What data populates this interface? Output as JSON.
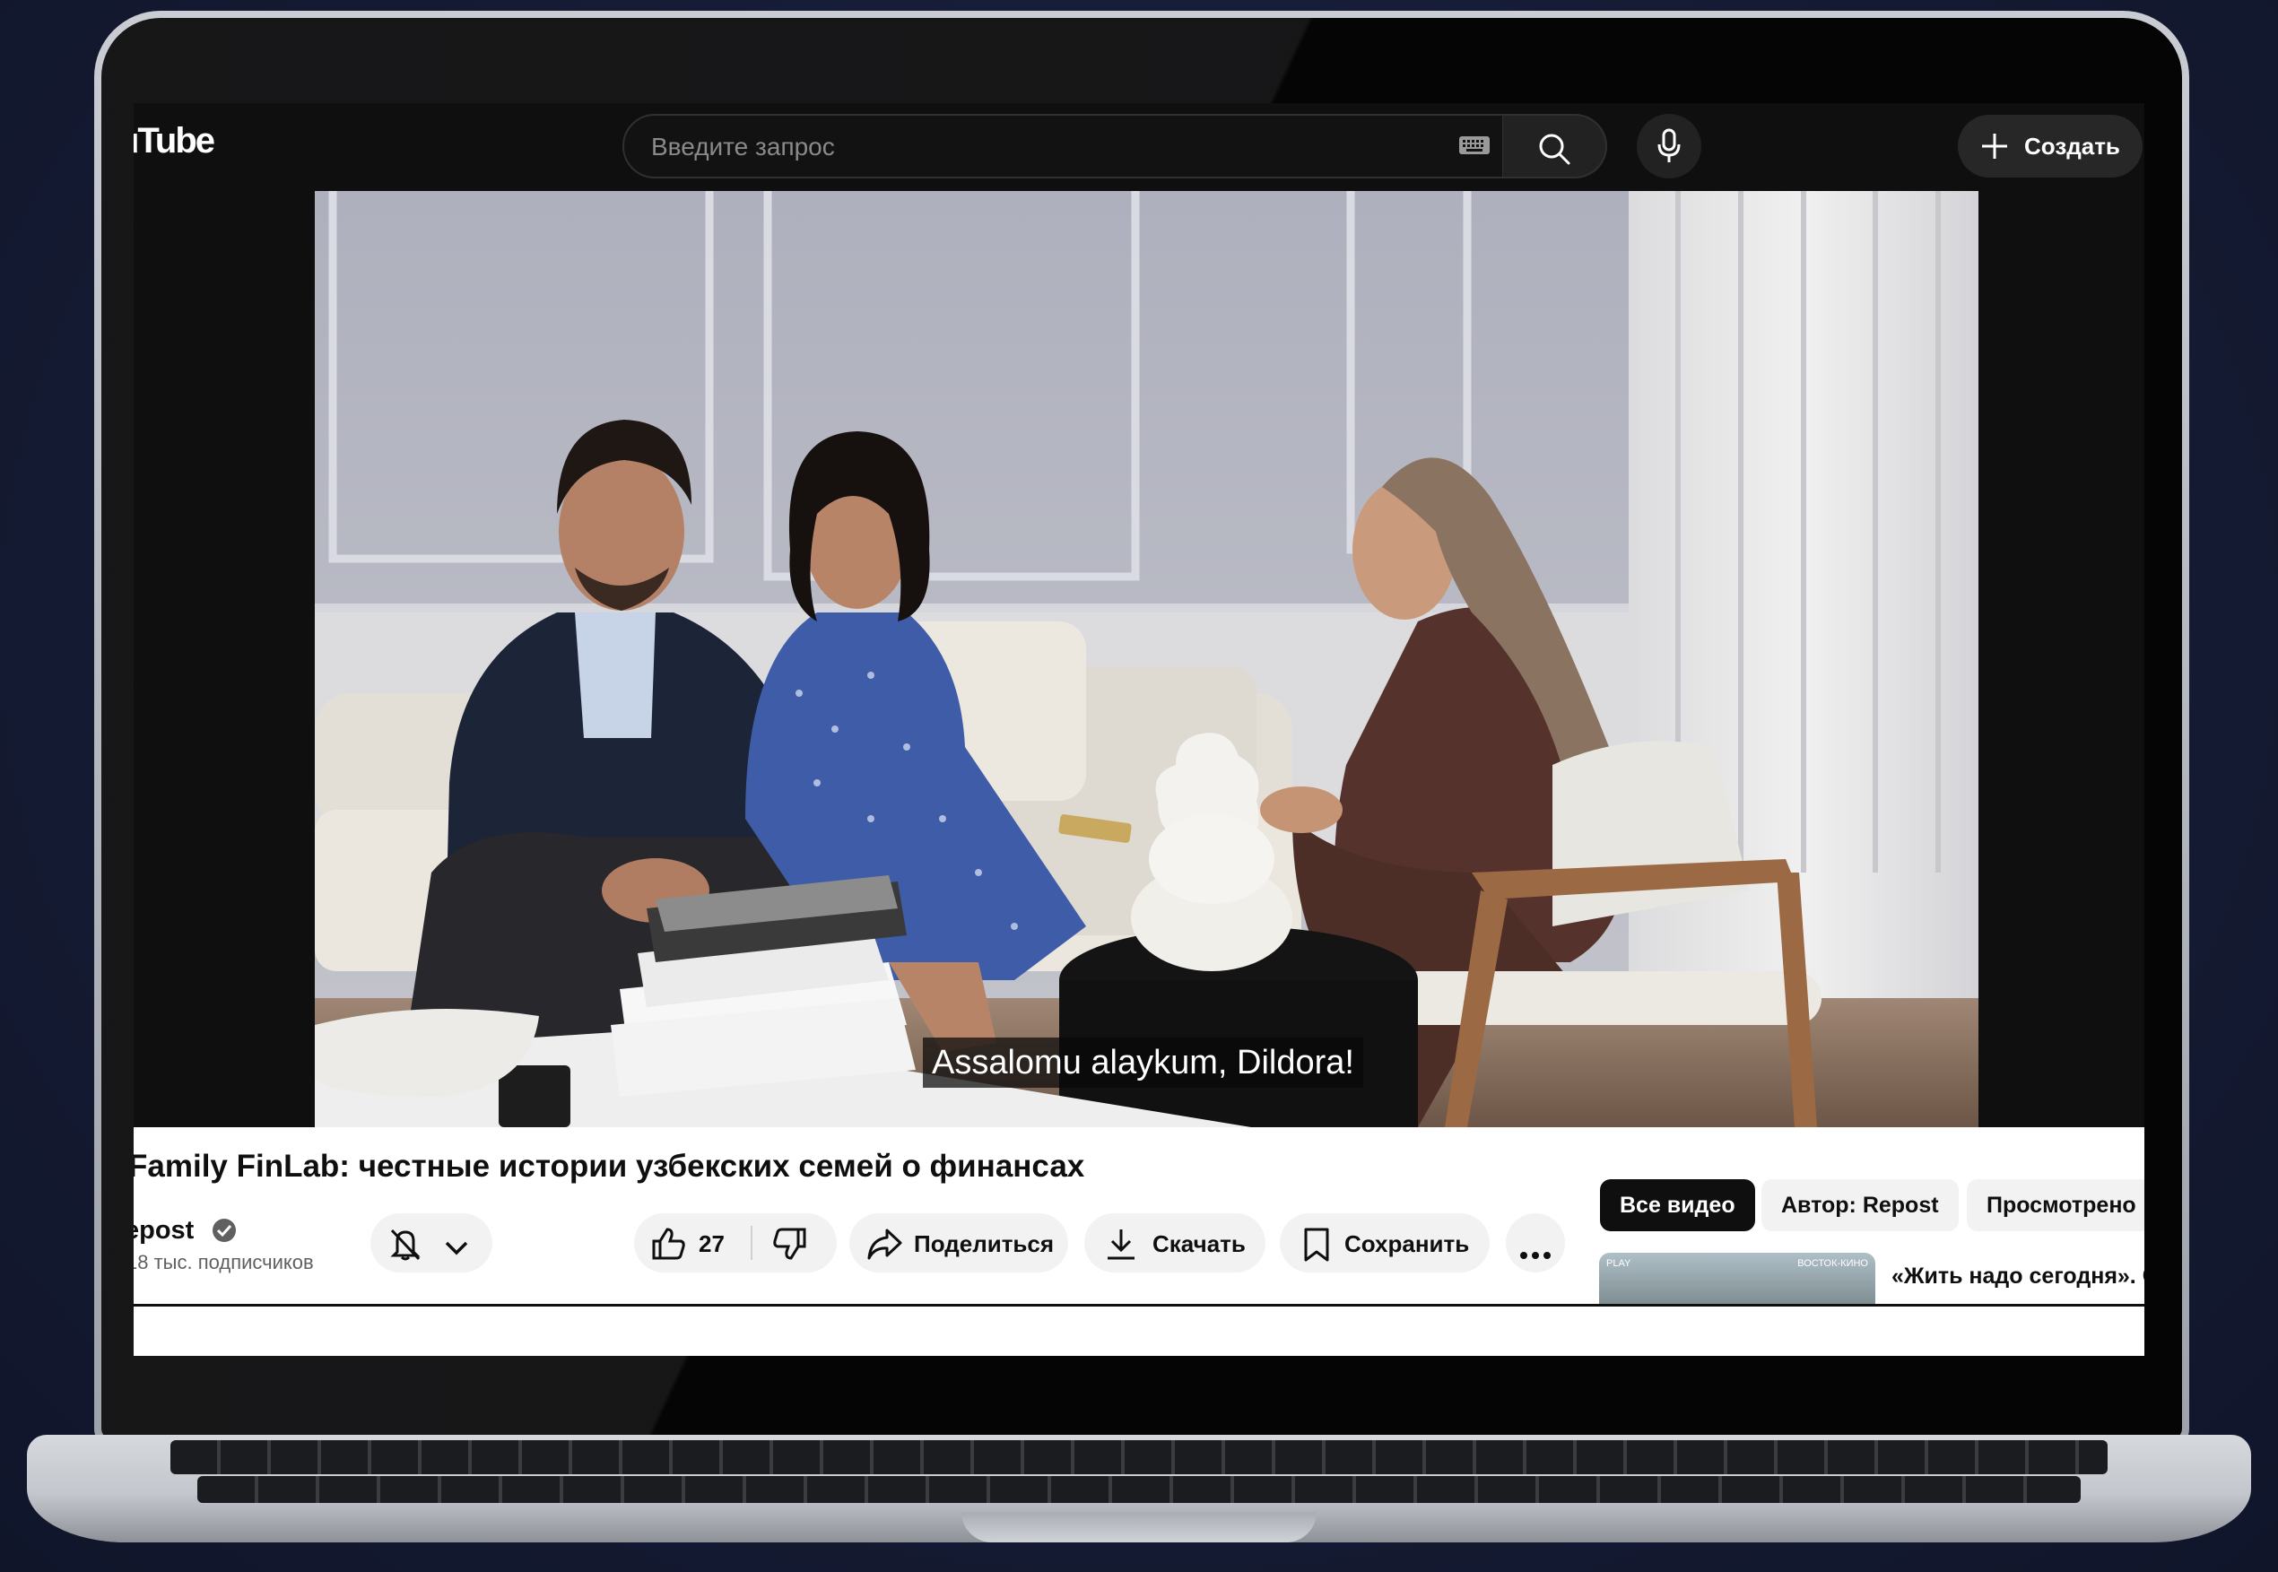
{
  "header": {
    "logo_text": "uTube",
    "search_placeholder": "Введите запрос",
    "create_label": "Создать"
  },
  "video": {
    "caption": "Assalomu alaykum, Dildora!"
  },
  "details": {
    "title": "Family FinLab: честные истории узбекских семей о финансах",
    "channel_name": "epost",
    "subscribers": "18 тыс. подписчиков",
    "like_count": "27",
    "share_label": "Поделиться",
    "download_label": "Скачать",
    "save_label": "Сохранить"
  },
  "chips": [
    "Все видео",
    "Автор: Repost",
    "Просмотрено"
  ],
  "recommendation": {
    "title": "«Жить надо сегодня». С",
    "thumb_tag_left": "PLAY",
    "thumb_tag_right": "ВОСТОК-КИНО"
  },
  "colors": {
    "header_bg": "#0f0f0f",
    "chip_active_bg": "#0f0f0f",
    "pill_bg": "#f2f2f2",
    "page_bg": "#151b33"
  }
}
